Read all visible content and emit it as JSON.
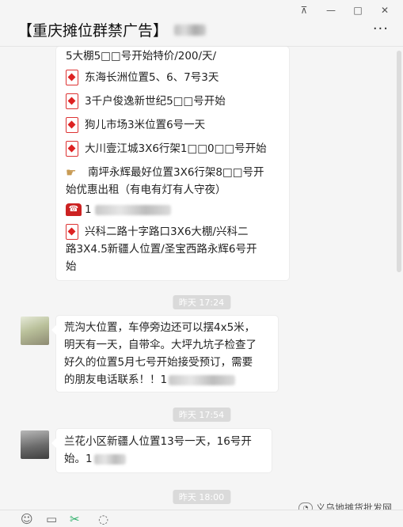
{
  "window": {
    "title": "【重庆摊位群禁广告】",
    "buttons": {
      "pin": "⊼",
      "minimize": "—",
      "maximize": "□",
      "close": "✕"
    },
    "more": "···"
  },
  "messages": [
    {
      "lines": [
        {
          "icon": "none",
          "text": "5大棚5□□号开始特价/200/天/"
        },
        {
          "icon": "diamond-card-icon",
          "text": "东海长洲位置5、6、7号3天"
        },
        {
          "icon": "diamond-card-icon",
          "text": "3千户俊逸新世纪5□□号开始"
        },
        {
          "icon": "diamond-card-icon",
          "text": "狗儿市场3米位置6号一天"
        },
        {
          "icon": "diamond-card-icon",
          "text": "大川壹江城3X6行架1□□0□□号开始"
        },
        {
          "icon": "pointing-hand-icon",
          "text": "南坪永辉最好位置3X6行架8□□号开"
        },
        {
          "icon": "none",
          "text": "始优惠出租（有电有灯有人守夜）"
        },
        {
          "icon": "telephone-icon",
          "text": "1"
        },
        {
          "icon": "diamond-card-icon",
          "text": "兴科二路十字路口3X6大棚/兴科二"
        },
        {
          "icon": "none",
          "text": "路3X4.5新疆人位置/圣宝西路永辉6号开"
        },
        {
          "icon": "none",
          "text": "始"
        }
      ]
    },
    {
      "time": "昨天 17:24",
      "lines": [
        "荒沟大位置，车停旁边还可以摆4x5米，",
        "明天有一天，自带伞。大坪九坑子检查了",
        "好久的位置5月七号开始接受预订，需要",
        "的朋友电话联系！！1"
      ]
    },
    {
      "time": "昨天 17:54",
      "lines": [
        "兰花小区新疆人位置13号一天，16号开",
        "始。1"
      ]
    },
    {
      "time": "昨天 18:00"
    }
  ],
  "toolbar": {
    "emoji": "☺",
    "folder": "▭",
    "scissors": "✂",
    "chat": "◌"
  },
  "watermark": {
    "text": "义乌地摊货批发网"
  }
}
